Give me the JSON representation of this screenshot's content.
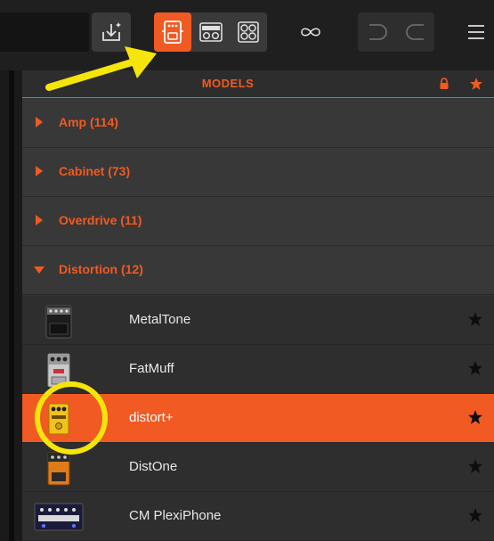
{
  "panel": {
    "title": "MODELS"
  },
  "categories": [
    {
      "label": "Amp (114)",
      "expanded": false
    },
    {
      "label": "Cabinet (73)",
      "expanded": false
    },
    {
      "label": "Overdrive (11)",
      "expanded": false
    },
    {
      "label": "Distortion (12)",
      "expanded": true
    }
  ],
  "models": [
    {
      "label": "MetalTone",
      "selected": false
    },
    {
      "label": "FatMuff",
      "selected": false
    },
    {
      "label": "distort+",
      "selected": true
    },
    {
      "label": "DistOne",
      "selected": false
    },
    {
      "label": "CM PlexiPhone",
      "selected": false
    }
  ],
  "icons": {
    "save": "download-icon",
    "view_stomp": "stompbox-view-icon",
    "view_amp": "amp-view-icon",
    "view_cab": "cabinet-view-icon",
    "loop": "infinity-icon",
    "undo": "undo-icon",
    "redo": "redo-icon",
    "menu": "hamburger-menu-icon",
    "lock": "lock-icon",
    "favorite": "star-icon"
  },
  "colors": {
    "accent": "#f15a22",
    "annotation": "#f5e50a",
    "background": "#2e2e2e"
  }
}
